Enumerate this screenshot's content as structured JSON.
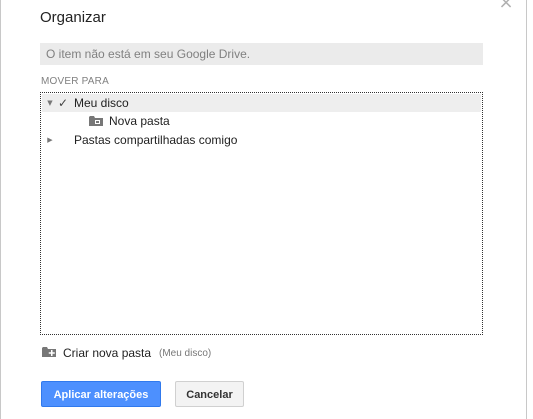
{
  "dialog": {
    "title": "Organizar",
    "close_glyph": "×",
    "notice": "O item não está em seu Google Drive.",
    "section_label": "MOVER PARA"
  },
  "tree": {
    "items": [
      {
        "label": "Meu disco",
        "selected": true,
        "checked": true,
        "expanded": true,
        "icon": "checkmark-icon"
      },
      {
        "label": "Nova pasta",
        "icon": "folder-icon"
      },
      {
        "label": "Pastas compartilhadas comigo",
        "expanded": false
      }
    ],
    "toggle_expanded_glyph": "▼",
    "toggle_collapsed_glyph": "▶",
    "check_glyph": "✓"
  },
  "create_folder": {
    "label": "Criar nova pasta",
    "hint": "(Meu disco)",
    "icon": "add-folder-icon"
  },
  "buttons": {
    "apply_label": "Aplicar alterações",
    "cancel_label": "Cancelar"
  },
  "colors": {
    "primary": "#4d90fe",
    "notice_bg": "#ebebeb",
    "selected_row_bg": "#eeeeee",
    "folder_icon": "#777777"
  }
}
